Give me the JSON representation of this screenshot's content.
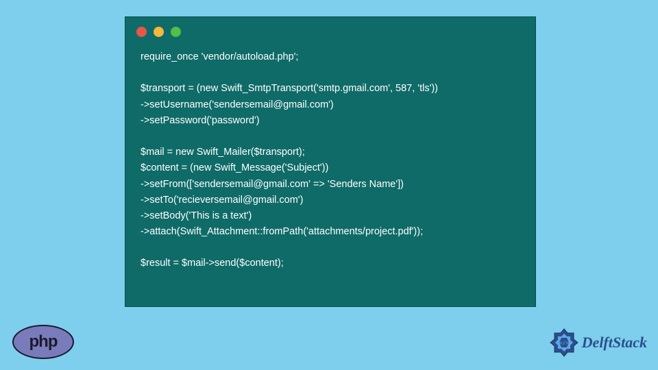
{
  "code": {
    "line1": "require_once 'vendor/autoload.php';",
    "line2": "",
    "line3": "$transport = (new Swift_SmtpTransport('smtp.gmail.com', 587, 'tls'))",
    "line4": "->setUsername('sendersemail@gmail.com')",
    "line5": "->setPassword('password')",
    "line6": "",
    "line7": "$mail = new Swift_Mailer($transport);",
    "line8": "$content = (new Swift_Message('Subject'))",
    "line9": "->setFrom(['sendersemail@gmail.com' => 'Senders Name'])",
    "line10": "->setTo('recieversemail@gmail.com')",
    "line11": "->setBody('This is a text')",
    "line12": "->attach(Swift_Attachment::fromPath('attachments/project.pdf'));",
    "line13": "",
    "line14": "$result = $mail->send($content);"
  },
  "php_label": "php",
  "brand_name": "DelftStack"
}
